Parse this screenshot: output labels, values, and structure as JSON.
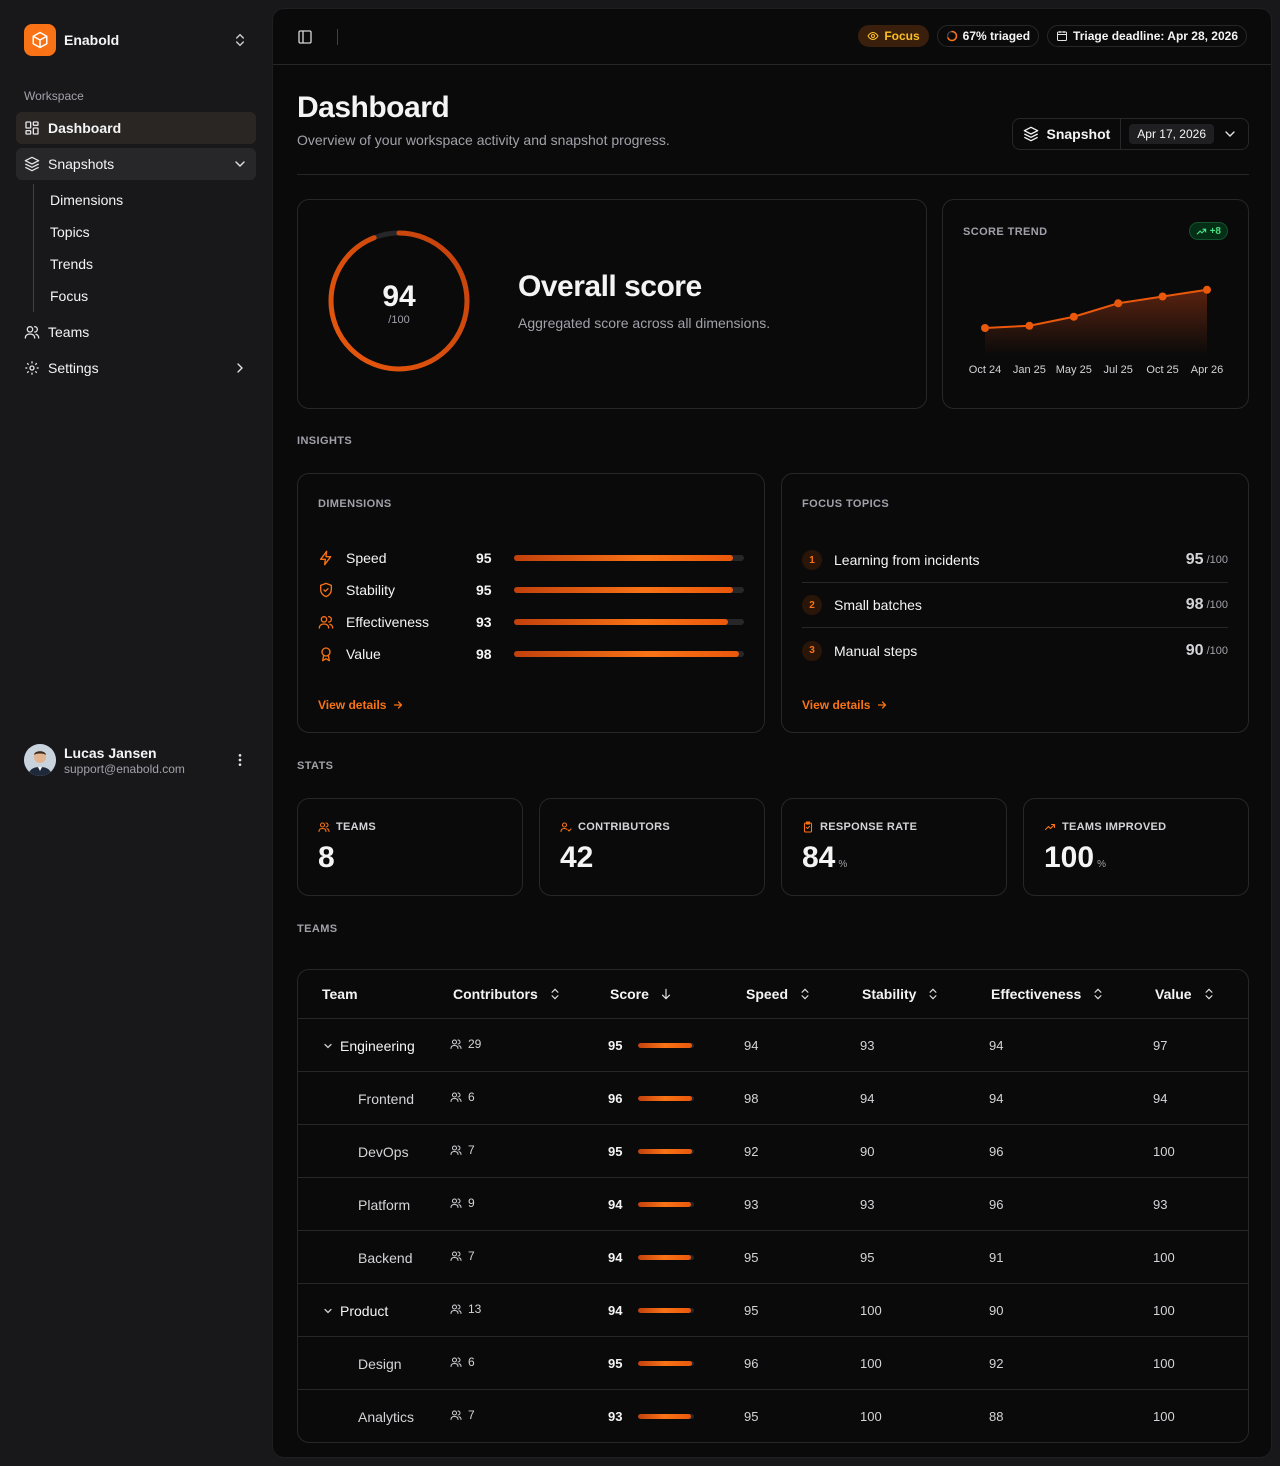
{
  "app": {
    "name": "Enabold"
  },
  "sidebar": {
    "section_label": "Workspace",
    "items": [
      {
        "label": "Dashboard",
        "icon": "dashboard-icon"
      },
      {
        "label": "Snapshots",
        "icon": "layers-icon"
      },
      {
        "label": "Teams",
        "icon": "users-icon"
      },
      {
        "label": "Settings",
        "icon": "gear-icon"
      }
    ],
    "snapshot_subitems": [
      "Dimensions",
      "Topics",
      "Trends",
      "Focus"
    ],
    "user": {
      "name": "Lucas Jansen",
      "email": "support@enabold.com"
    }
  },
  "topbar": {
    "focus_label": "Focus",
    "triaged_label": "67% triaged",
    "triaged_fraction": 0.67,
    "deadline_label": "Triage deadline: Apr 28, 2026"
  },
  "header": {
    "title": "Dashboard",
    "subtitle": "Overview of your workspace activity and snapshot progress.",
    "snapshot_label": "Snapshot",
    "snapshot_date": "Apr 17, 2026"
  },
  "overall": {
    "score": "94",
    "max": "/100",
    "score_fraction": 0.94,
    "title": "Overall score",
    "subtitle": "Aggregated score across all dimensions."
  },
  "trend": {
    "label": "SCORE TREND",
    "badge": "+8"
  },
  "chart_data": {
    "type": "area",
    "x": [
      "Oct 24",
      "Jan 25",
      "May 25",
      "Jul 25",
      "Oct 25",
      "Apr 26"
    ],
    "values": [
      86,
      86.5,
      88.5,
      91.5,
      93,
      94.5
    ],
    "ylim": [
      80,
      100
    ]
  },
  "sections": {
    "insights": "INSIGHTS",
    "stats": "STATS",
    "teams": "TEAMS"
  },
  "dimensions": {
    "label": "DIMENSIONS",
    "items": [
      {
        "name": "Speed",
        "value": "95",
        "fraction": 0.95,
        "icon": "bolt-icon"
      },
      {
        "name": "Stability",
        "value": "95",
        "fraction": 0.95,
        "icon": "shield-icon"
      },
      {
        "name": "Effectiveness",
        "value": "93",
        "fraction": 0.93,
        "icon": "users-icon"
      },
      {
        "name": "Value",
        "value": "98",
        "fraction": 0.98,
        "icon": "award-icon"
      }
    ],
    "link": "View details"
  },
  "focus_topics": {
    "label": "FOCUS TOPICS",
    "items": [
      {
        "num": "1",
        "name": "Learning from incidents",
        "score": "95",
        "max": "/100"
      },
      {
        "num": "2",
        "name": "Small batches",
        "score": "98",
        "max": "/100"
      },
      {
        "num": "3",
        "name": "Manual steps",
        "score": "90",
        "max": "/100"
      }
    ],
    "link": "View details"
  },
  "stats": [
    {
      "label": "TEAMS",
      "value": "8",
      "unit": "",
      "icon": "users-icon"
    },
    {
      "label": "CONTRIBUTORS",
      "value": "42",
      "unit": "",
      "icon": "user-check-icon"
    },
    {
      "label": "RESPONSE RATE",
      "value": "84",
      "unit": "%",
      "icon": "clipboard-icon"
    },
    {
      "label": "TEAMS IMPROVED",
      "value": "100",
      "unit": "%",
      "icon": "trending-up-icon"
    }
  ],
  "table": {
    "headers": [
      "Team",
      "Contributors",
      "Score",
      "Speed",
      "Stability",
      "Effectiveness",
      "Value"
    ],
    "rows": [
      {
        "team": "Engineering",
        "parent": true,
        "contributors": "29",
        "score": "95",
        "speed": "94",
        "stability": "93",
        "effectiveness": "94",
        "value": "97"
      },
      {
        "team": "Frontend",
        "parent": false,
        "contributors": "6",
        "score": "96",
        "speed": "98",
        "stability": "94",
        "effectiveness": "94",
        "value": "94"
      },
      {
        "team": "DevOps",
        "parent": false,
        "contributors": "7",
        "score": "95",
        "speed": "92",
        "stability": "90",
        "effectiveness": "96",
        "value": "100"
      },
      {
        "team": "Platform",
        "parent": false,
        "contributors": "9",
        "score": "94",
        "speed": "93",
        "stability": "93",
        "effectiveness": "96",
        "value": "93"
      },
      {
        "team": "Backend",
        "parent": false,
        "contributors": "7",
        "score": "94",
        "speed": "95",
        "stability": "95",
        "effectiveness": "91",
        "value": "100"
      },
      {
        "team": "Product",
        "parent": true,
        "contributors": "13",
        "score": "94",
        "speed": "95",
        "stability": "100",
        "effectiveness": "90",
        "value": "100"
      },
      {
        "team": "Design",
        "parent": false,
        "contributors": "6",
        "score": "95",
        "speed": "96",
        "stability": "100",
        "effectiveness": "92",
        "value": "100"
      },
      {
        "team": "Analytics",
        "parent": false,
        "contributors": "7",
        "score": "93",
        "speed": "95",
        "stability": "100",
        "effectiveness": "88",
        "value": "100"
      }
    ]
  },
  "colors": {
    "accent": "#f97316",
    "accent_dark": "#c2410c",
    "background": "#0a0a0a",
    "sidebar": "#18181b",
    "positive": "#4ade80"
  }
}
